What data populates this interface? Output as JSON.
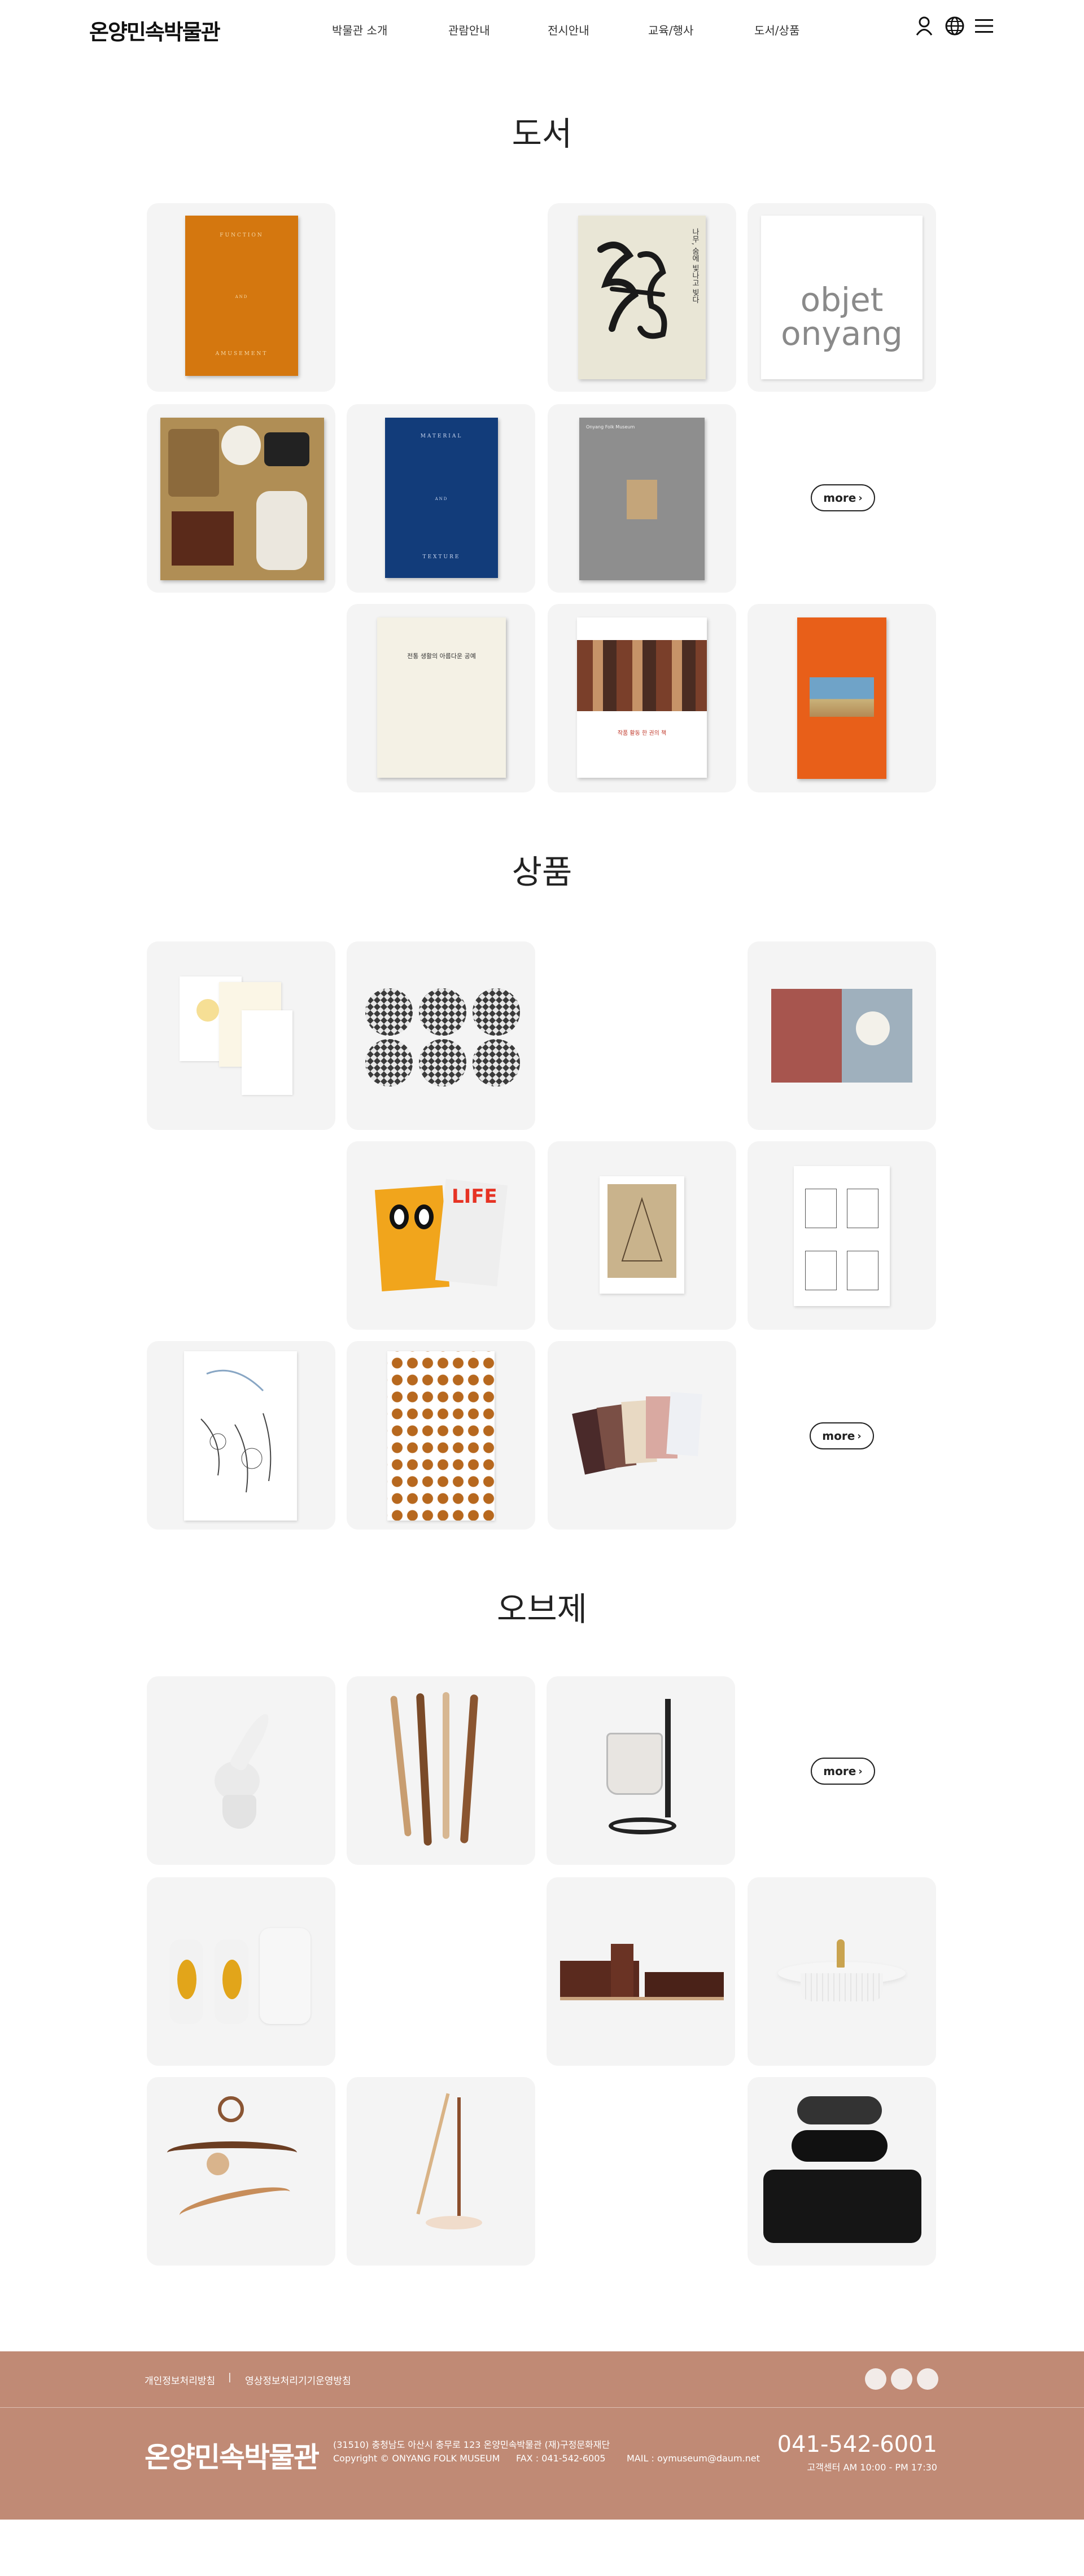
{
  "header": {
    "logo": "온양민속박물관",
    "nav": [
      "박물관 소개",
      "관람안내",
      "전시안내",
      "교육/행사",
      "도서/상품"
    ],
    "icons": [
      "user-icon",
      "globe-icon",
      "menu-icon"
    ]
  },
  "sections": {
    "books": {
      "title": "도서",
      "more": "more"
    },
    "goods": {
      "title": "상품",
      "more": "more"
    },
    "objets": {
      "title": "오브제",
      "more": "more"
    }
  },
  "books": {
    "function_title": "FUNCTION",
    "function_and": "AND",
    "function_sub": "AMUSEMENT",
    "calligraphy_text": "나무, 숨에 빛나고 빚다",
    "objet_line1": "objet",
    "objet_line2": "onyang",
    "material_title": "MATERIAL",
    "material_and": "AND",
    "material_sub": "TEXTURE",
    "catalog_grey_text": "Onyang Folk Museum",
    "white_book_text": "전통 생활의 아름다운 공예",
    "photo_book_text": "작품 활동 한 권의 책"
  },
  "goods": {
    "life_text": "LIFE"
  },
  "footer": {
    "privacy": "개인정보처리방침",
    "separator": "|",
    "video_policy": "영상정보처리기기운영방침",
    "logo": "온양민속박물관",
    "address": "(31510) 충청남도 아산시 충무로 123 온양민속박물관 (재)구정문화재단",
    "copyright": "Copyright © ONYANG FOLK MUSEUM",
    "fax": "FAX : 041-542-6005",
    "mail": "MAIL : oymuseum@daum.net",
    "phone": "041-542-6001",
    "hours": "고객센터 AM 10:00 - PM 17:30"
  },
  "colors": {
    "footer_bg": "#c08a75",
    "card_bg": "#f4f4f4",
    "orange_book": "#d4770f",
    "navy_book": "#123c7a",
    "red_orange_book": "#e85f19"
  }
}
